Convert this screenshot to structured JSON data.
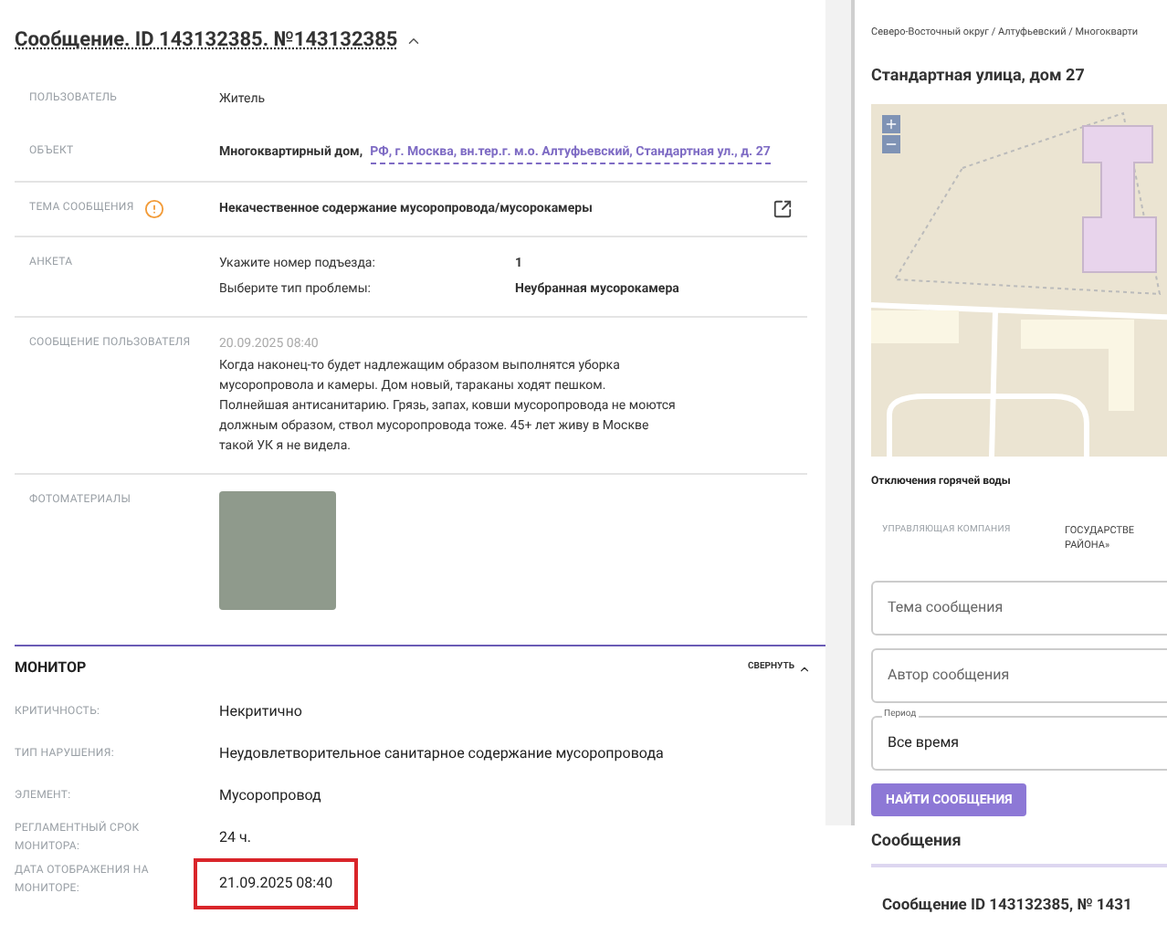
{
  "title": "Сообщение. ID 143132385. №143132385",
  "fields": [
    {
      "kind": "text",
      "label": "ПОЛЬЗОВАТЕЛЬ",
      "value": "Житель",
      "divider": false
    },
    {
      "kind": "object",
      "label": "ОБЪЕКТ",
      "value": "Многоквартирный дом,",
      "link": "РФ, г. Москва, вн.тер.г. м.о. Алтуфьевский, Стандартная ул., д. 27",
      "divider": false
    },
    {
      "kind": "topic",
      "label": "ТЕМА СООБЩЕНИЯ",
      "value": "Некачественное содержание мусоропровода/мусорокамеры",
      "divider": true
    },
    {
      "kind": "survey",
      "label": "АНКЕТА",
      "rows": [
        {
          "q": "Укажите номер подъезда:",
          "a": "1"
        },
        {
          "q": "Выберите тип проблемы:",
          "a": "Неубранная мусорокамера"
        }
      ],
      "divider": true
    },
    {
      "kind": "message",
      "label": "СООБЩЕНИЕ ПОЛЬЗОВАТЕЛЯ",
      "date": "20.09.2025 08:40",
      "value": "Когда наконец-то будет надлежащим образом выполнятся уборка мусоропровола и камеры. Дом новый, тараканы ходят пешком. Полнейшая антисанитарию. Грязь, запах, ковши мусоропровода не моются должным образом, ствол мусоропровода тоже. 45+ лет живу в Москве такой УК я не видела.",
      "divider": true
    },
    {
      "kind": "photos",
      "label": "ФОТОМАТЕРИАЛЫ",
      "divider": true
    }
  ],
  "monitor": {
    "title": "МОНИТОР",
    "collapse": "СВЕРНУТЬ",
    "rows": [
      {
        "label": "КРИТИЧНОСТЬ:",
        "value": "Некритично",
        "highlighted": false
      },
      {
        "label": "ТИП НАРУШЕНИЯ:",
        "value": "Неудовлетворительное санитарное содержание мусоропровода",
        "highlighted": false
      },
      {
        "label": "ЭЛЕМЕНТ:",
        "value": "Мусоропровод",
        "highlighted": false
      },
      {
        "label": "РЕГЛАМЕНТНЫЙ СРОК МОНИТОРА:",
        "value": "24 ч.",
        "highlighted": false
      },
      {
        "label": "ДАТА ОТОБРАЖЕНИЯ НА МОНИТОРЕ:",
        "value": "21.09.2025 08:40",
        "highlighted": true
      }
    ]
  },
  "side": {
    "breadcrumb": "Северо-Восточный округ / Алтуфьевский / Многокварти",
    "address": "Стандартная улица, дом 27",
    "outages": "Отключения горячей воды",
    "company_label": "УПРАВЛЯЮЩАЯ КОМПАНИЯ",
    "company_value": "ГОСУДАРСТВЕ РАЙОНА»",
    "filters": [
      {
        "kind": "input",
        "placeholder": "Тема сообщения"
      },
      {
        "kind": "input",
        "placeholder": "Автор сообщения"
      },
      {
        "kind": "select",
        "label": "Период",
        "value": "Все время"
      }
    ],
    "search_button": "НАЙТИ СООБЩЕНИЯ",
    "messages_title": "Сообщения",
    "message_item": "Сообщение ID 143132385, № 1431"
  }
}
